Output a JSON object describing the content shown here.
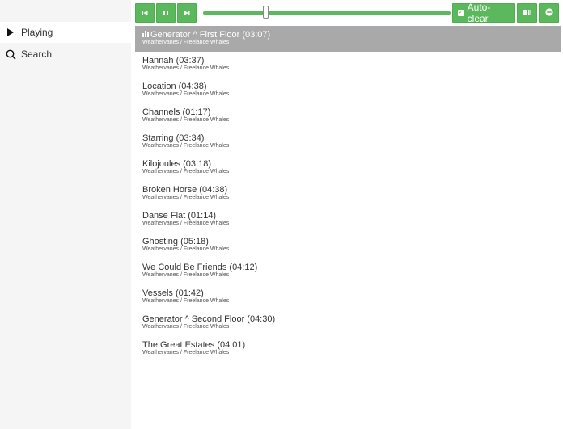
{
  "sidebar": {
    "items": [
      {
        "label": "Playing",
        "icon": "play-icon",
        "active": true
      },
      {
        "label": "Search",
        "icon": "search-icon",
        "active": false
      }
    ]
  },
  "toolbar": {
    "prev_icon": "skip-back-icon",
    "pause_icon": "pause-icon",
    "next_icon": "skip-forward-icon",
    "progress": 0.25,
    "autoclear_label": "Auto-clear",
    "autoclear_checked": true,
    "queue_icon": "queue-icon",
    "remove_icon": "remove-icon",
    "accent_color": "#5cb85c"
  },
  "playlist": {
    "tracks": [
      {
        "title": "Generator ^ First Floor (03:07)",
        "subtitle": "Weathervanes / Freelance Whales",
        "current": true
      },
      {
        "title": "Hannah (03:37)",
        "subtitle": "Weathervanes / Freelance Whales"
      },
      {
        "title": "Location (04:38)",
        "subtitle": "Weathervanes / Freelance Whales"
      },
      {
        "title": "Channels (01:17)",
        "subtitle": "Weathervanes / Freelance Whales"
      },
      {
        "title": "Starring (03:34)",
        "subtitle": "Weathervanes / Freelance Whales"
      },
      {
        "title": "Kilojoules (03:18)",
        "subtitle": "Weathervanes / Freelance Whales"
      },
      {
        "title": "Broken Horse (04:38)",
        "subtitle": "Weathervanes / Freelance Whales"
      },
      {
        "title": "Danse Flat (01:14)",
        "subtitle": "Weathervanes / Freelance Whales"
      },
      {
        "title": "Ghosting (05:18)",
        "subtitle": "Weathervanes / Freelance Whales"
      },
      {
        "title": "We Could Be Friends (04:12)",
        "subtitle": "Weathervanes / Freelance Whales"
      },
      {
        "title": "Vessels (01:42)",
        "subtitle": "Weathervanes / Freelance Whales"
      },
      {
        "title": "Generator ^ Second Floor (04:30)",
        "subtitle": "Weathervanes / Freelance Whales"
      },
      {
        "title": "The Great Estates (04:01)",
        "subtitle": "Weathervanes / Freelance Whales"
      }
    ]
  }
}
